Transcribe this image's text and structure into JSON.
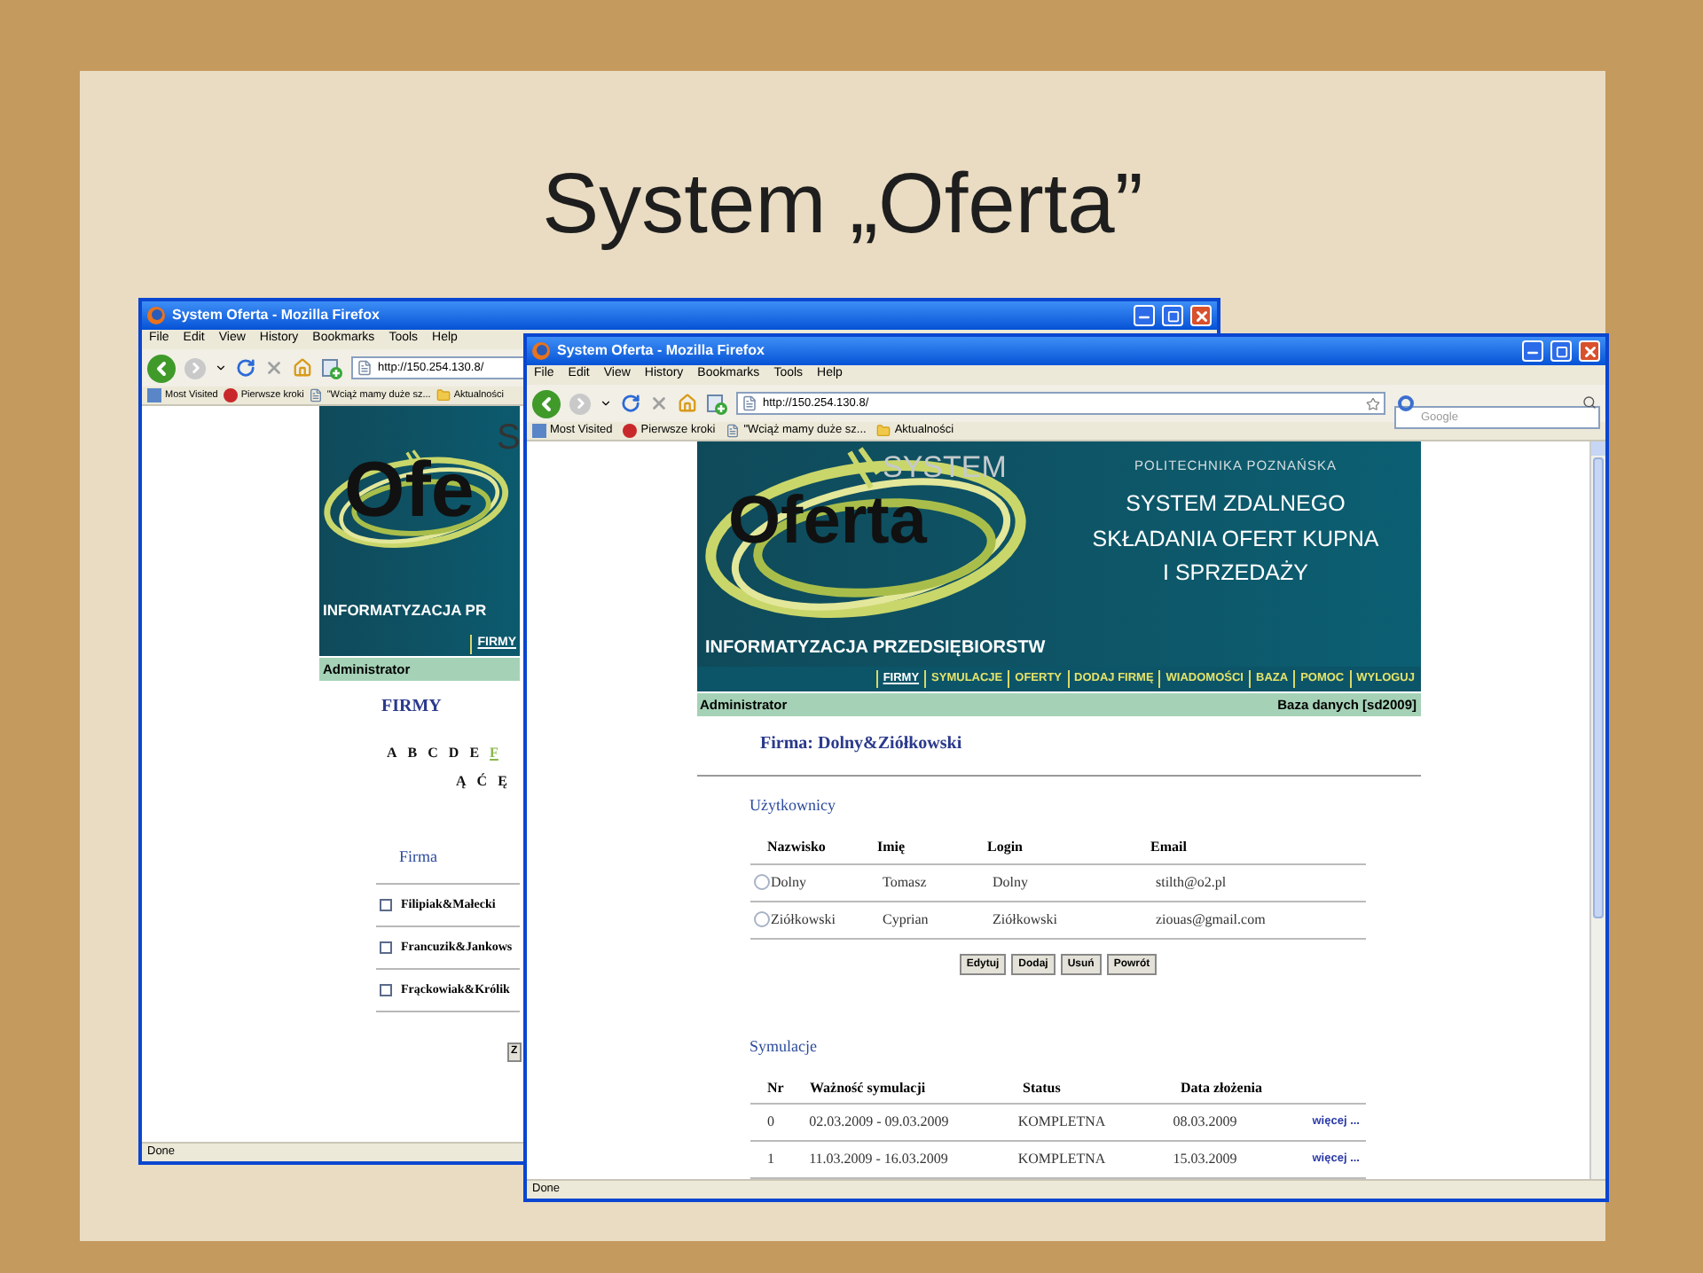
{
  "slide": {
    "title": "System „Oferta”"
  },
  "windows": [
    {
      "title": "System Oferta - Mozilla Firefox",
      "menu": [
        "File",
        "Edit",
        "View",
        "History",
        "Bookmarks",
        "Tools",
        "Help"
      ],
      "url": "http://150.254.130.8/",
      "bookmarks": [
        "Most Visited",
        "Pierwsze kroki",
        "\"Wciąż mamy duże sz...",
        "Aktualności"
      ],
      "status": "Done",
      "page": {
        "kind": "firms",
        "logo_top": "S",
        "logo": "Ofe",
        "banner_caption": "INFORMATYZACJA PR",
        "nav": [
          {
            "label": "FIRMY",
            "selected": true
          }
        ],
        "user": "Administrator",
        "heading": "FIRMY",
        "letters": [
          {
            "label": "A",
            "selected": false
          },
          {
            "label": "B",
            "selected": false
          },
          {
            "label": "C",
            "selected": false
          },
          {
            "label": "D",
            "selected": false
          },
          {
            "label": "E",
            "selected": false
          },
          {
            "label": "F",
            "selected": true
          }
        ],
        "letters_2": [
          "Ą",
          "Ć",
          "Ę"
        ],
        "column": "Firma",
        "firms": [
          {
            "name": "Filipiak&Małecki",
            "checked": false
          },
          {
            "name": "Francuzik&Jankows",
            "checked": false
          },
          {
            "name": "Frąckowiak&Królik",
            "checked": false
          }
        ],
        "buttons": [
          "Z"
        ]
      }
    },
    {
      "title": "System Oferta - Mozilla Firefox",
      "menu": [
        "File",
        "Edit",
        "View",
        "History",
        "Bookmarks",
        "Tools",
        "Help"
      ],
      "url": "http://150.254.130.8/",
      "search_placeholder": "Google",
      "bookmarks": [
        "Most Visited",
        "Pierwsze kroki",
        "\"Wciąż mamy duże sz...",
        "Aktualności"
      ],
      "status": "Done",
      "page": {
        "kind": "firm_detail",
        "logo_top": "SYSTEM",
        "logo": "Oferta",
        "university": "POLITECHNIKA POZNAŃSKA",
        "slogan": [
          "SYSTEM ZDALNEGO",
          "SKŁADANIA OFERT KUPNA",
          "I SPRZEDAŻY"
        ],
        "banner_caption": "INFORMATYZACJA PRZEDSIĘBIORSTW",
        "nav": [
          {
            "label": "FIRMY",
            "selected": true
          },
          {
            "label": "SYMULACJE",
            "selected": false
          },
          {
            "label": "OFERTY",
            "selected": false
          },
          {
            "label": "DODAJ FIRMĘ",
            "selected": false
          },
          {
            "label": "WIADOMOŚCI",
            "selected": false
          },
          {
            "label": "BAZA",
            "selected": false
          },
          {
            "label": "POMOC",
            "selected": false
          },
          {
            "label": "WYLOGUJ",
            "selected": false
          }
        ],
        "user": "Administrator",
        "database": "Baza danych [sd2009]",
        "heading": "Firma: Dolny&Ziółkowski",
        "users": {
          "title": "Użytkownicy",
          "columns": [
            "Nazwisko",
            "Imię",
            "Login",
            "Email"
          ],
          "rows": [
            {
              "selected": false,
              "cells": [
                "Dolny",
                "Tomasz",
                "Dolny",
                "stilth@o2.pl"
              ]
            },
            {
              "selected": false,
              "cells": [
                "Ziółkowski",
                "Cyprian",
                "Ziółkowski",
                "ziouas@gmail.com"
              ]
            }
          ]
        },
        "buttons": [
          "Edytuj",
          "Dodaj",
          "Usuń",
          "Powrót"
        ],
        "simulations": {
          "title": "Symulacje",
          "columns": [
            "Nr",
            "Ważność symulacji",
            "Status",
            "Data złożenia"
          ],
          "rows": [
            {
              "cells": [
                "0",
                "02.03.2009 - 09.03.2009",
                "KOMPLETNA",
                "08.03.2009"
              ],
              "link": "więcej ..."
            },
            {
              "cells": [
                "1",
                "11.03.2009 - 16.03.2009",
                "KOMPLETNA",
                "15.03.2009"
              ],
              "link": "więcej ..."
            }
          ]
        }
      }
    }
  ]
}
